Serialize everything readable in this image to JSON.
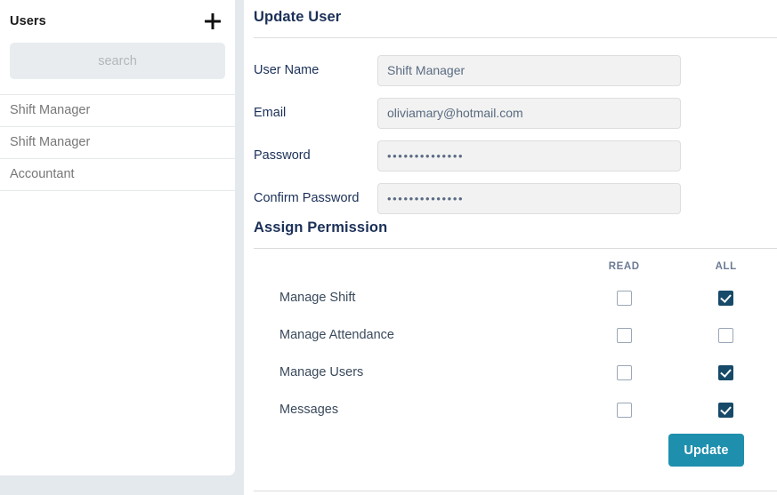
{
  "sidebar": {
    "title": "Users",
    "add_icon": "plus-icon",
    "search": {
      "placeholder": "search",
      "value": ""
    },
    "items": [
      {
        "label": "Shift Manager"
      },
      {
        "label": "Shift Manager"
      },
      {
        "label": "Accountant"
      }
    ]
  },
  "main": {
    "heading": "Update User",
    "fields": [
      {
        "label": "User Name",
        "value": "Shift Manager",
        "type": "text"
      },
      {
        "label": "Email",
        "value": "oliviamary@hotmail.com",
        "type": "text"
      },
      {
        "label": "Password",
        "value": "••••••••••••••",
        "type": "password"
      },
      {
        "label": "Confirm Password",
        "value": "••••••••••••••",
        "type": "password"
      }
    ],
    "permissions": {
      "heading": "Assign Permission",
      "columns": [
        "",
        "READ",
        "ALL"
      ],
      "rows": [
        {
          "name": "Manage Shift",
          "read": false,
          "all": true
        },
        {
          "name": "Manage Attendance",
          "read": false,
          "all": false
        },
        {
          "name": "Manage Users",
          "read": false,
          "all": true
        },
        {
          "name": "Messages",
          "read": false,
          "all": true
        }
      ]
    },
    "submit_label": "Update"
  },
  "colors": {
    "page_background": "#e4e9ed",
    "card_background": "#ffffff",
    "heading_navy": "#1b3058",
    "checkbox_checked": "#164a68",
    "button_teal": "#1f8fae",
    "column_header": "#6b7a94",
    "input_background": "#f2f2f2",
    "search_background": "#e8ecef"
  }
}
